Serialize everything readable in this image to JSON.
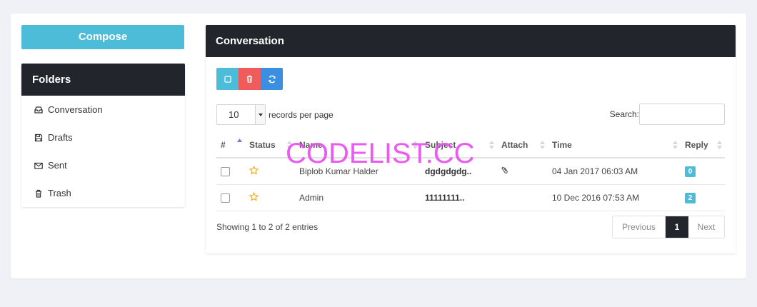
{
  "compose_label": "Compose",
  "folders": {
    "title": "Folders",
    "items": [
      {
        "label": "Conversation",
        "icon": "inbox-icon"
      },
      {
        "label": "Drafts",
        "icon": "save-icon"
      },
      {
        "label": "Sent",
        "icon": "envelope-icon"
      },
      {
        "label": "Trash",
        "icon": "trash-icon"
      }
    ]
  },
  "panel": {
    "title": "Conversation",
    "toolbar": {
      "select_all_icon": "square-icon",
      "delete_icon": "trash-icon",
      "refresh_icon": "refresh-icon"
    },
    "length": {
      "value": "10",
      "suffix": "records per page"
    },
    "search": {
      "label": "Search:",
      "value": ""
    },
    "columns": [
      "#",
      "Status",
      "Name",
      "Subject",
      "Attach",
      "Time",
      "Reply"
    ],
    "rows": [
      {
        "name": "Biplob Kumar Halder",
        "subject": "dgdgdgdg..",
        "attach": "paperclip-icon",
        "time": "04 Jan 2017 06:03 AM",
        "reply": "0"
      },
      {
        "name": "Admin",
        "subject": "11111111..",
        "attach": "",
        "time": "10 Dec 2016 07:53 AM",
        "reply": "2"
      }
    ],
    "info": "Showing 1 to 2 of 2 entries",
    "pagination": {
      "previous": "Previous",
      "current": "1",
      "next": "Next"
    }
  },
  "watermark": "CODELIST.CC",
  "colors": {
    "accent": "#4cbcd8",
    "danger": "#f05b5b",
    "primary": "#3a8fe0",
    "dark": "#22252b",
    "star": "#f0a92b"
  }
}
